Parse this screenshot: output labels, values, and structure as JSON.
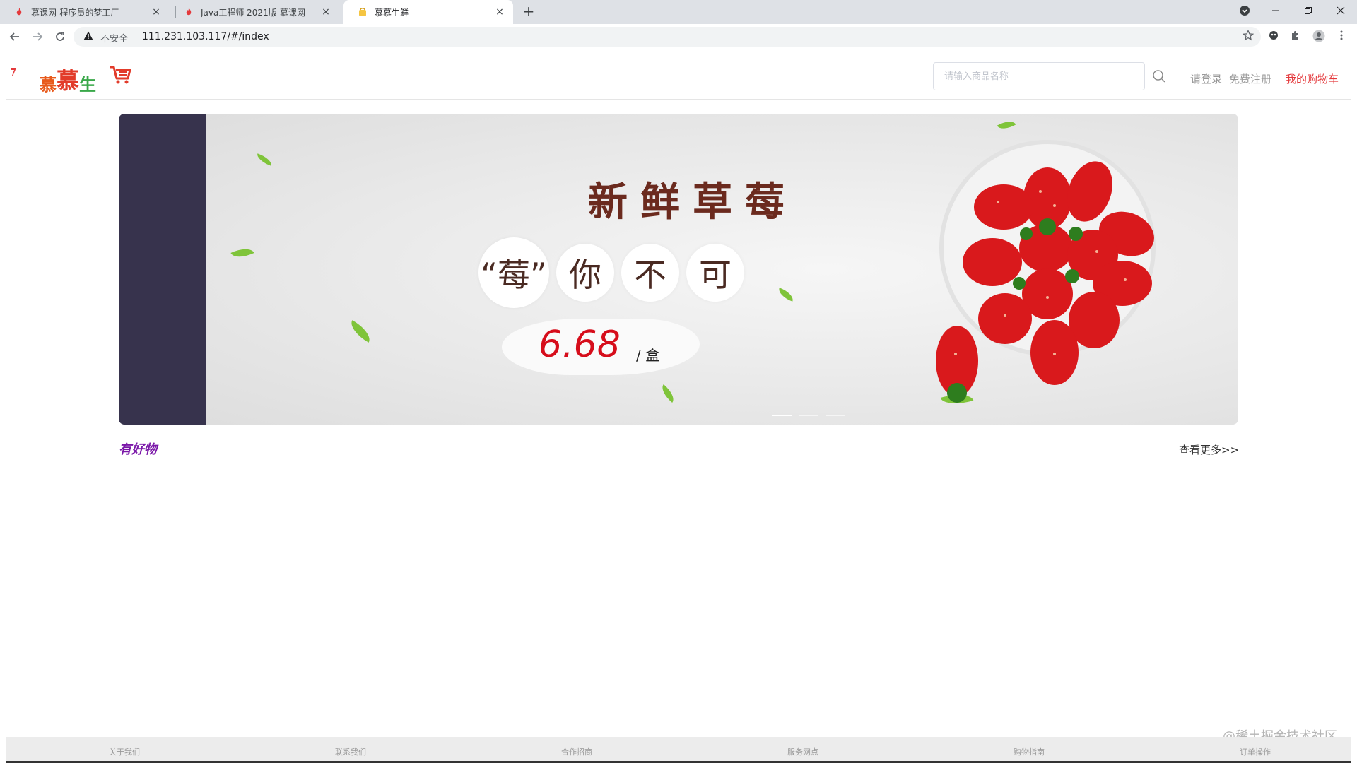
{
  "browser": {
    "tabs": [
      {
        "title": "慕课网-程序员的梦工厂",
        "close": "×",
        "favicon": "flame-icon"
      },
      {
        "title": "Java工程师 2021版-慕课网",
        "close": "×",
        "favicon": "flame-icon"
      },
      {
        "title": "慕慕生鲜",
        "close": "×",
        "favicon": "basket-icon",
        "active": true
      }
    ],
    "new_tab": "+",
    "address": {
      "security_label": "不安全",
      "url": "111.231.103.117/#/index"
    }
  },
  "header": {
    "logo": {
      "char1": "慕",
      "char2": "慕",
      "char3": "生"
    },
    "search_placeholder": "请输入商品名称",
    "login": "请登录",
    "register": "免费注册",
    "cart": "我的购物车"
  },
  "banner": {
    "headline": "新鲜草莓",
    "circles": [
      "“莓”",
      "你",
      "不",
      "可"
    ],
    "price": "6.68",
    "unit": "/ 盒",
    "slides_total": 3,
    "active_slide": 1
  },
  "section": {
    "title": "有好物",
    "more": "查看更多>>"
  },
  "footer": {
    "links": [
      "关于我们",
      "联系我们",
      "合作招商",
      "服务网点",
      "购物指南",
      "订单操作"
    ]
  },
  "watermark": "@稀土掘金技术社区",
  "colors": {
    "accent_red": "#e4393c",
    "price_red": "#d60d1b",
    "section_purple": "#7a16a8",
    "banner_dark": "#37334d"
  }
}
